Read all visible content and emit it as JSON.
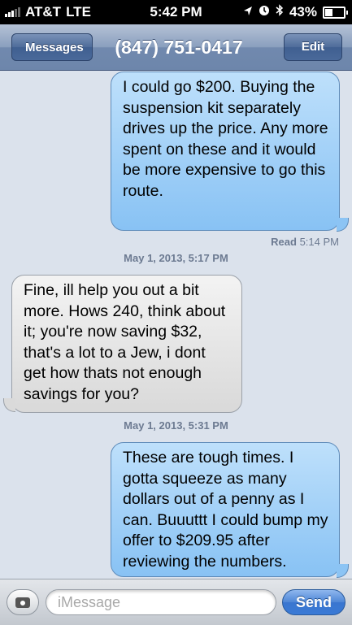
{
  "status_bar": {
    "carrier": "AT&T",
    "network": "LTE",
    "time": "5:42 PM",
    "battery": "43%",
    "battery_level": 0.43,
    "icons": [
      "signal-bars-icon",
      "location-arrow-icon",
      "alarm-icon",
      "bluetooth-icon",
      "battery-icon"
    ]
  },
  "nav": {
    "back_label": "Messages",
    "title": "(847) 751-0417",
    "edit_label": "Edit"
  },
  "conversation": {
    "messages": [
      {
        "direction": "sent",
        "text": "I could go $200. Buying the suspension kit separately drives up the price. Any more spent on these and it would be more expensive to go this route."
      },
      {
        "direction": "received",
        "text": "Fine, ill help you out a bit more. Hows 240, think about it; you're now saving $32, that's a lot to a Jew, i dont get how thats not enough savings for you?"
      },
      {
        "direction": "sent",
        "text": "These are tough times. I gotta squeeze as many dollars out of a penny as I can. Buuuttt I could bump my offer to $209.95 after reviewing the numbers."
      }
    ],
    "read_receipt": {
      "label": "Read",
      "time": "5:14 PM"
    },
    "timestamps": [
      "May 1, 2013, 5:17 PM",
      "May 1, 2013, 5:31 PM"
    ]
  },
  "input_bar": {
    "placeholder": "iMessage",
    "value": "",
    "send_label": "Send"
  },
  "colors": {
    "sent_bubble": "#88c2f4",
    "received_bubble": "#d9d9d9",
    "background": "#dbe2ec",
    "send_button": "#3a76cf"
  }
}
